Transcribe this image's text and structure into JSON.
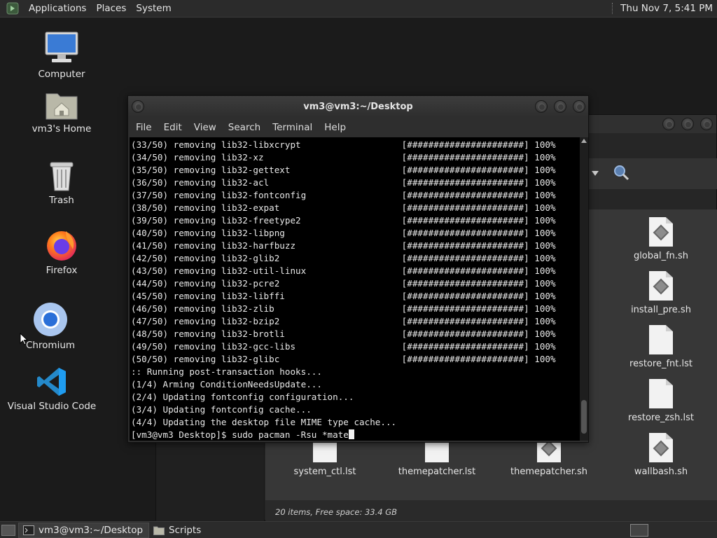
{
  "top_panel": {
    "menus": [
      "Applications",
      "Places",
      "System"
    ],
    "clock": "Thu Nov 7,  5:41 PM"
  },
  "desktop_icons": [
    {
      "label": "Computer",
      "icon": "computer-icon"
    },
    {
      "label": "vm3's Home",
      "icon": "home-folder-icon"
    },
    {
      "label": "Trash",
      "icon": "trash-icon"
    },
    {
      "label": "Firefox",
      "icon": "firefox-icon"
    },
    {
      "label": "Chromium",
      "icon": "chromium-icon"
    },
    {
      "label": "Visual Studio Code",
      "icon": "vscode-icon"
    }
  ],
  "terminal": {
    "title": "vm3@vm3:~/Desktop",
    "menus": [
      "File",
      "Edit",
      "View",
      "Search",
      "Terminal",
      "Help"
    ],
    "removals": [
      {
        "step": "(33/50)",
        "pkg": "lib32-libxcrypt"
      },
      {
        "step": "(34/50)",
        "pkg": "lib32-xz"
      },
      {
        "step": "(35/50)",
        "pkg": "lib32-gettext"
      },
      {
        "step": "(36/50)",
        "pkg": "lib32-acl"
      },
      {
        "step": "(37/50)",
        "pkg": "lib32-fontconfig"
      },
      {
        "step": "(38/50)",
        "pkg": "lib32-expat"
      },
      {
        "step": "(39/50)",
        "pkg": "lib32-freetype2"
      },
      {
        "step": "(40/50)",
        "pkg": "lib32-libpng"
      },
      {
        "step": "(41/50)",
        "pkg": "lib32-harfbuzz"
      },
      {
        "step": "(42/50)",
        "pkg": "lib32-glib2"
      },
      {
        "step": "(43/50)",
        "pkg": "lib32-util-linux"
      },
      {
        "step": "(44/50)",
        "pkg": "lib32-pcre2"
      },
      {
        "step": "(45/50)",
        "pkg": "lib32-libffi"
      },
      {
        "step": "(46/50)",
        "pkg": "lib32-zlib"
      },
      {
        "step": "(47/50)",
        "pkg": "lib32-bzip2"
      },
      {
        "step": "(48/50)",
        "pkg": "lib32-brotli"
      },
      {
        "step": "(49/50)",
        "pkg": "lib32-gcc-libs"
      },
      {
        "step": "(50/50)",
        "pkg": "lib32-glibc"
      }
    ],
    "verb": "removing",
    "progress_bar": "[######################]",
    "percent": "100%",
    "post_lines": [
      ":: Running post-transaction hooks...",
      "(1/4) Arming ConditionNeedsUpdate...",
      "(2/4) Updating fontconfig configuration...",
      "(3/4) Updating fontconfig cache...",
      "(4/4) Updating the desktop file MIME type cache..."
    ],
    "prompt": "[vm3@vm3 Desktop]$ ",
    "command": "sudo pacman -Rsu *mate"
  },
  "file_manager": {
    "files_right": [
      "global_fn.sh",
      "install_pre.sh",
      "restore_fnt.lst",
      "restore_zsh.lst"
    ],
    "files_bottom": [
      "system_ctl.lst",
      "themepatcher.lst",
      "themepatcher.sh",
      "wallbash.sh"
    ],
    "status": "20 items, Free space: 33.4 GB"
  },
  "taskbar": {
    "items": [
      "vm3@vm3:~/Desktop",
      "Scripts"
    ]
  }
}
